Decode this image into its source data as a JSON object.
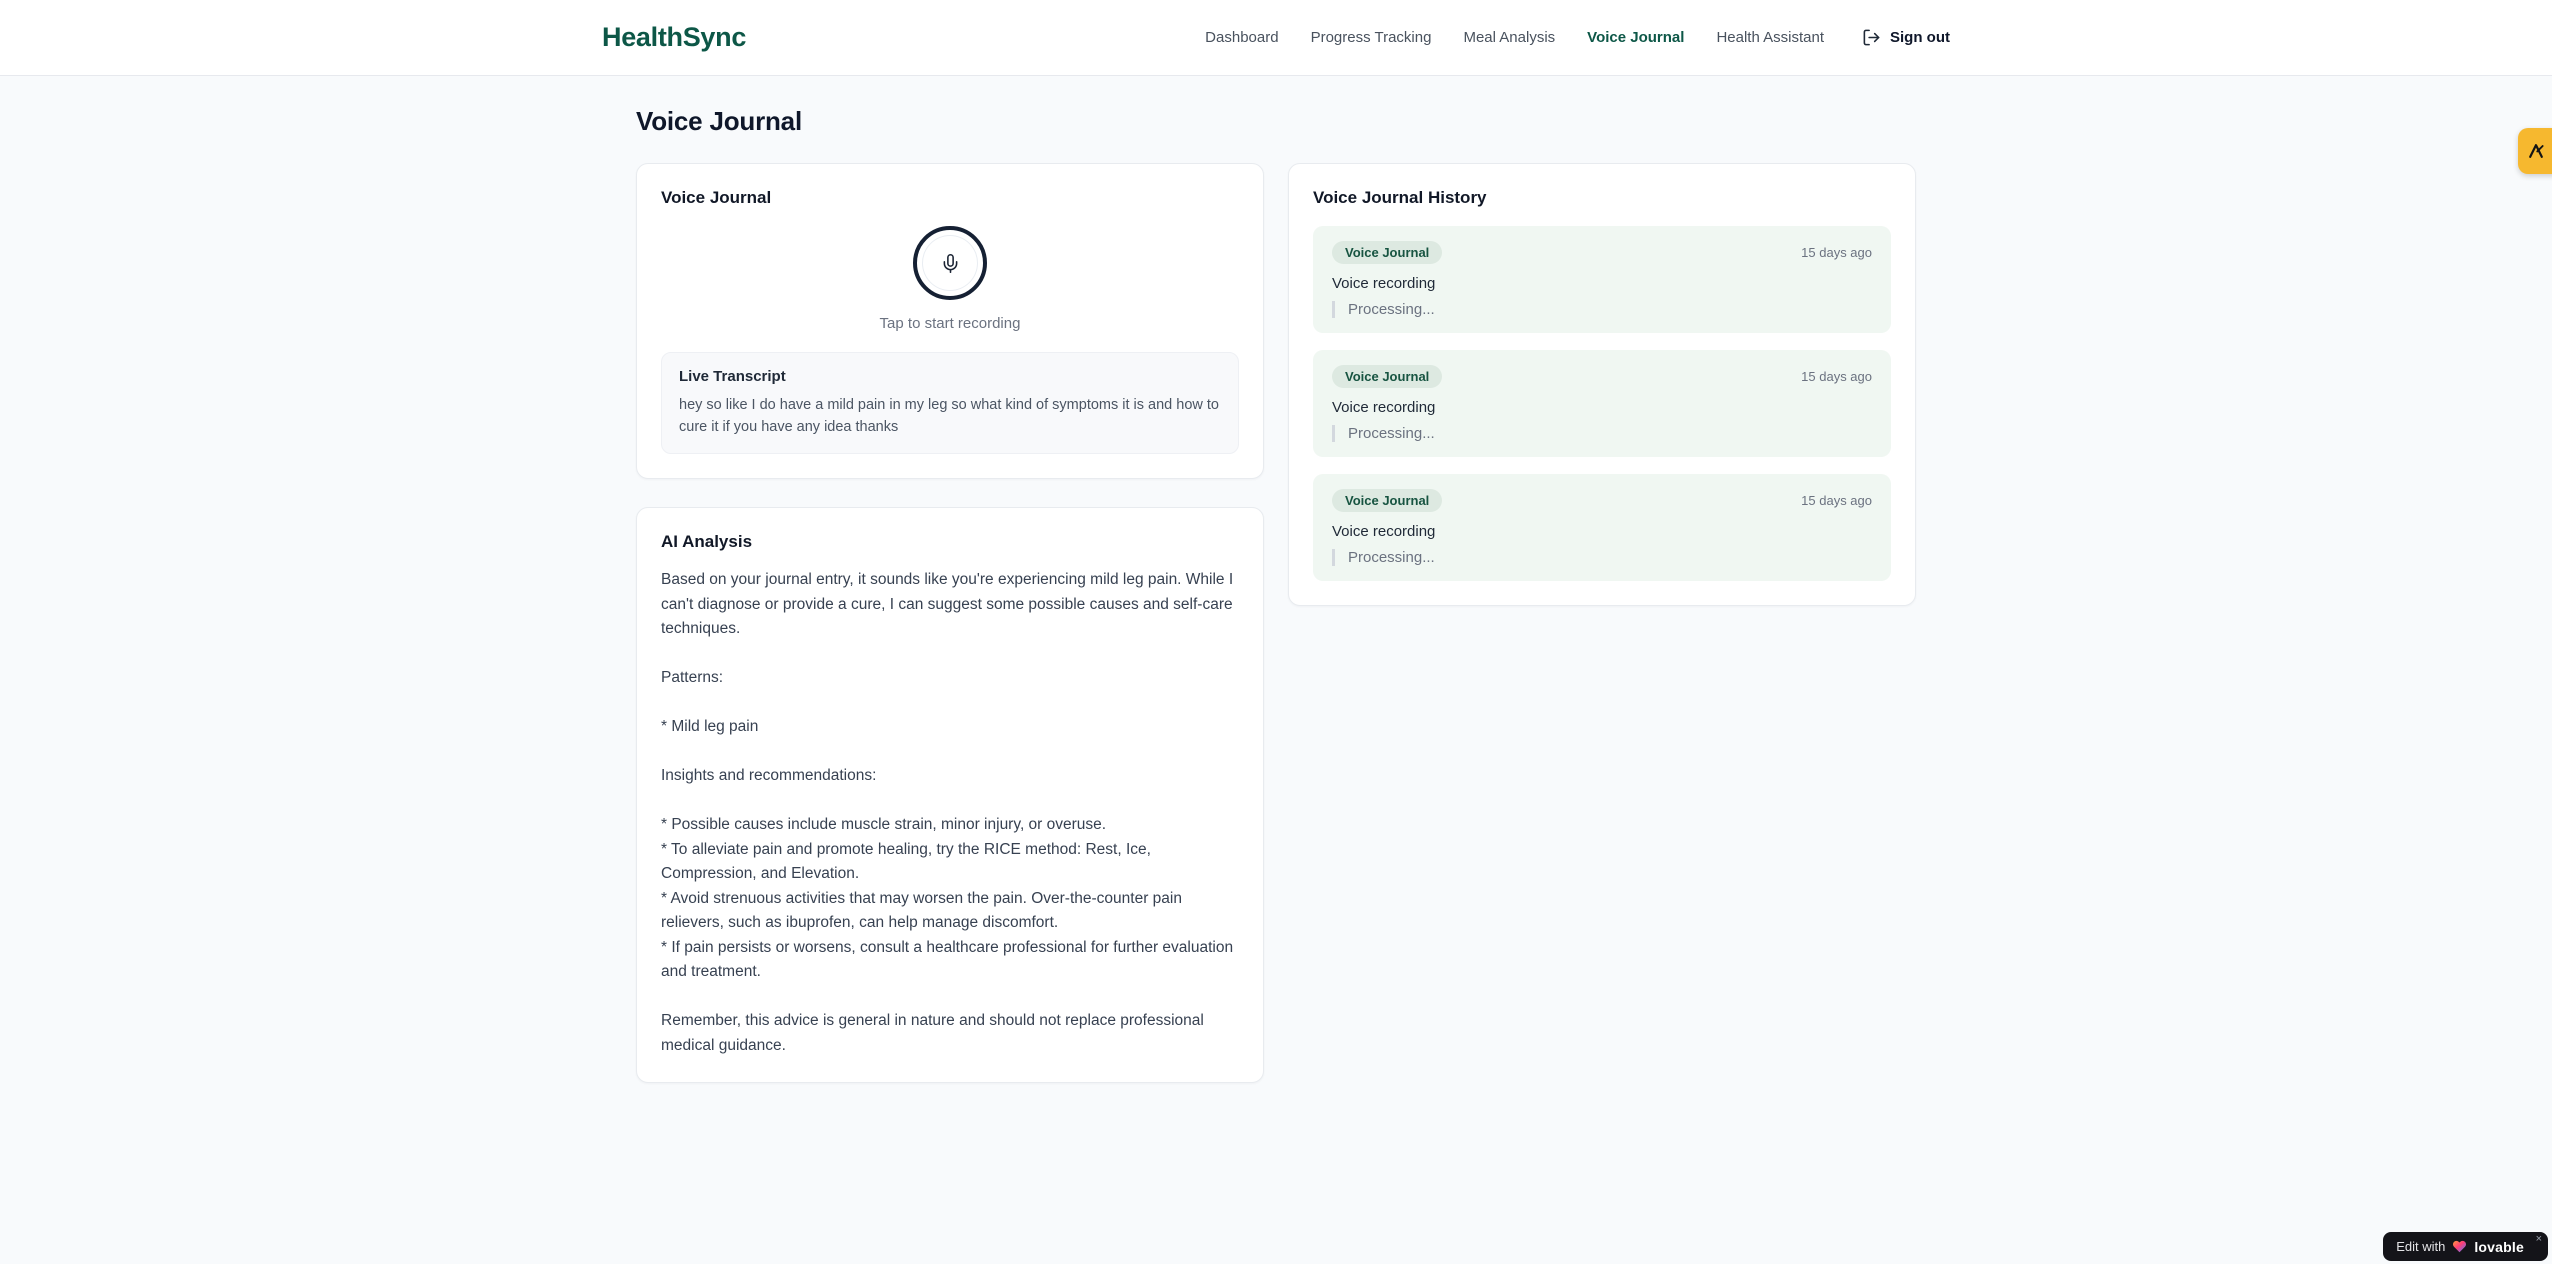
{
  "brand": {
    "name": "HealthSync",
    "color": "#0d5747"
  },
  "nav": {
    "items": [
      {
        "label": "Dashboard",
        "active": false
      },
      {
        "label": "Progress Tracking",
        "active": false
      },
      {
        "label": "Meal Analysis",
        "active": false
      },
      {
        "label": "Voice Journal",
        "active": true
      },
      {
        "label": "Health Assistant",
        "active": false
      }
    ],
    "signout_label": "Sign out"
  },
  "page": {
    "title": "Voice Journal"
  },
  "recorder": {
    "card_title": "Voice Journal",
    "tap_hint": "Tap to start recording",
    "mic_icon": "microphone-icon",
    "transcript": {
      "title": "Live Transcript",
      "text": "hey so like I do have a mild pain in my leg so what kind of symptoms it is and how to cure it if you have any idea thanks"
    }
  },
  "analysis": {
    "card_title": "AI Analysis",
    "body": "Based on your journal entry, it sounds like you're experiencing mild leg pain. While I can't diagnose or provide a cure, I can suggest some possible causes and self-care techniques.\n\nPatterns:\n\n* Mild leg pain\n\nInsights and recommendations:\n\n* Possible causes include muscle strain, minor injury, or overuse.\n* To alleviate pain and promote healing, try the RICE method: Rest, Ice, Compression, and Elevation.\n* Avoid strenuous activities that may worsen the pain. Over-the-counter pain relievers, such as ibuprofen, can help manage discomfort.\n* If pain persists or worsens, consult a healthcare professional for further evaluation and treatment.\n\nRemember, this advice is general in nature and should not replace professional medical guidance."
  },
  "history": {
    "card_title": "Voice Journal History",
    "entries": [
      {
        "badge": "Voice Journal",
        "time": "15 days ago",
        "title": "Voice recording",
        "status": "Processing..."
      },
      {
        "badge": "Voice Journal",
        "time": "15 days ago",
        "title": "Voice recording",
        "status": "Processing..."
      },
      {
        "badge": "Voice Journal",
        "time": "15 days ago",
        "title": "Voice recording",
        "status": "Processing..."
      }
    ]
  },
  "floating": {
    "amber_badge_color": "#f6b82f",
    "lovable": {
      "prefix": "Edit with",
      "brand": "lovable",
      "close": "×"
    }
  },
  "colors": {
    "accent_green": "#0d5747",
    "badge_bg": "#dde9e1",
    "badge_text": "#175441",
    "entry_bg": "#f0f7f2",
    "page_bg": "#f8fafc"
  }
}
